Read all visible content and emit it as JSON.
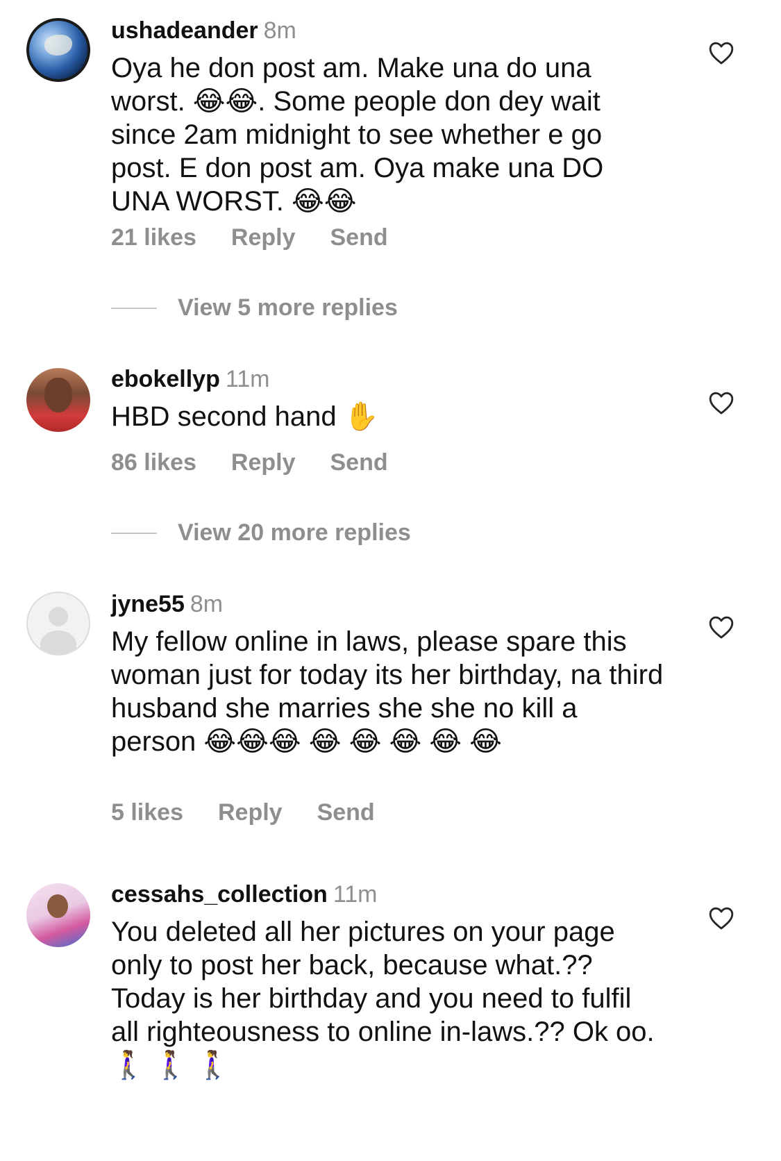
{
  "comments": [
    {
      "username": "ushadeander",
      "time": "8m",
      "text": "Oya he don post am. Make una do una worst. 😂😂. Some people don dey wait since 2am midnight to see whether e go post. E don post am. Oya make una DO UNA WORST. 😂😂",
      "likes": "21 likes",
      "reply": "Reply",
      "send": "Send",
      "view_replies": "View 5 more replies",
      "avatar": "globe-avatar"
    },
    {
      "username": "ebokellyp",
      "time": "11m",
      "text": "HBD second hand ✋",
      "likes": "86 likes",
      "reply": "Reply",
      "send": "Send",
      "view_replies": "View 20 more replies",
      "avatar": "person-avatar"
    },
    {
      "username": "jyne55",
      "time": "8m",
      "text": "My fellow online in laws, please spare this woman just for today its her birthday, na third husband she marries she she no kill a person 😂😂😂 😂 😂 😂 😂 😂",
      "likes": "5 likes",
      "reply": "Reply",
      "send": "Send",
      "avatar": "default-avatar"
    },
    {
      "username": "cessahs_collection",
      "time": "11m",
      "text": "You deleted all her pictures on your page only to post her back, because what.?? Today is her birthday and you need to fulfil all righteousness to online in-laws.?? Ok oo. 🚶‍♀️ 🚶‍♀️ 🚶‍♀️",
      "avatar": "woman-avatar"
    }
  ],
  "icons": {
    "like": "heart-outline-icon"
  },
  "colors": {
    "secondary_text": "#8e8e8e",
    "divider": "#c7c7c7"
  }
}
